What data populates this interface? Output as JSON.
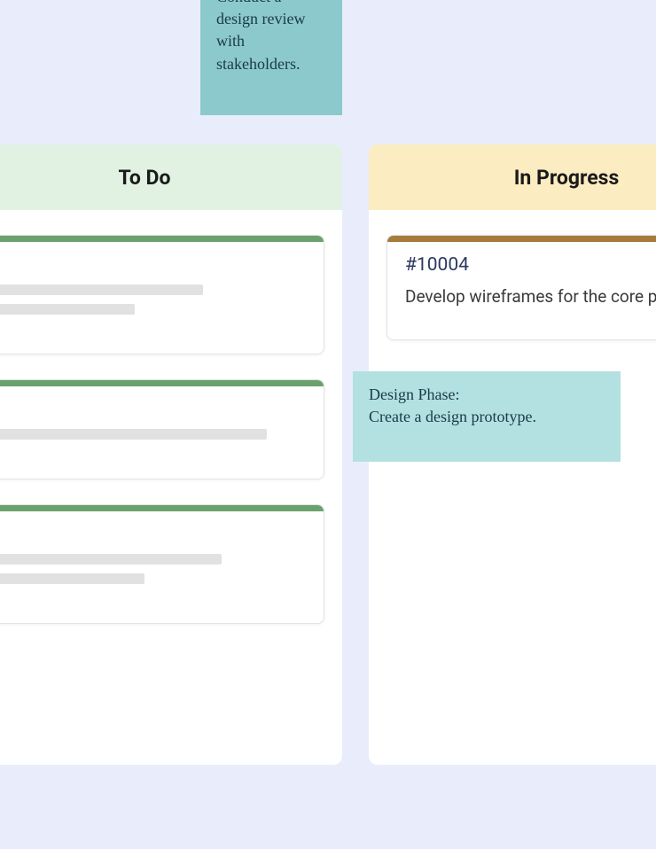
{
  "stickies": {
    "top": "Conduct a design review with stakeholders.",
    "mid_line1": "Design Phase:",
    "mid_line2": "Create a design prototype."
  },
  "columns": {
    "todo": {
      "title": "To Do",
      "cards": [
        {
          "id": "1"
        },
        {
          "id": "2"
        },
        {
          "id": "3"
        }
      ]
    },
    "in_progress": {
      "title": "In Progress",
      "cards": [
        {
          "id": "#10004",
          "desc": "Develop wireframes for the core pag"
        }
      ]
    }
  },
  "colors": {
    "todo_header": "#e1f2e3",
    "progress_header": "#fcecc2",
    "stripe_green": "#6aa26e",
    "stripe_brown": "#a77c3a",
    "sticky": "#a9d9d9"
  }
}
